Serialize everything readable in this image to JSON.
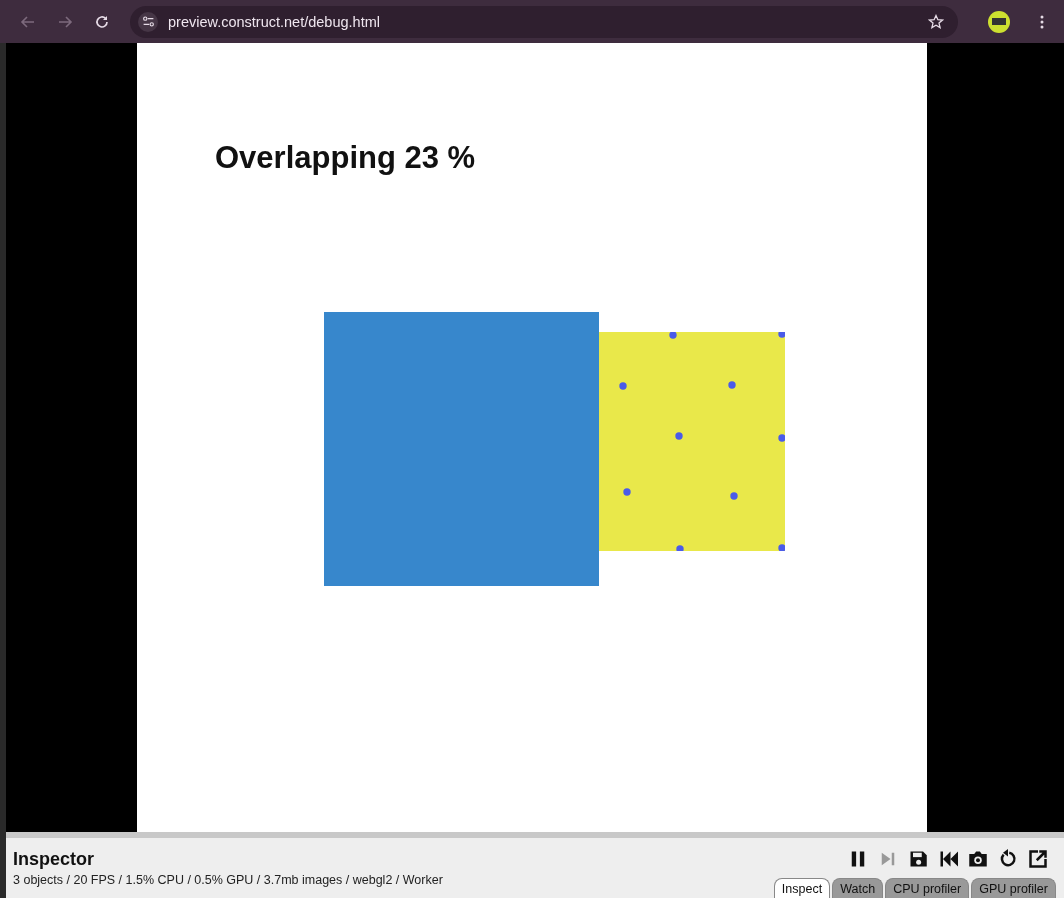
{
  "browser": {
    "url": "preview.construct.net/debug.html",
    "back_disabled": true,
    "forward_disabled": true
  },
  "game": {
    "title": "Overlapping 23 %"
  },
  "inspector": {
    "title": "Inspector",
    "stats": "3 objects / 20 FPS / 1.5% CPU / 0.5% GPU / 3.7mb images / webgl2 / Worker",
    "tools": [
      {
        "kind": "pause",
        "disabled": false
      },
      {
        "kind": "step",
        "disabled": true
      },
      {
        "kind": "save",
        "disabled": false
      },
      {
        "kind": "rewind",
        "disabled": false
      },
      {
        "kind": "camera",
        "disabled": false
      },
      {
        "kind": "restart",
        "disabled": false
      },
      {
        "kind": "popout",
        "disabled": false
      }
    ],
    "tabs": [
      {
        "label": "Inspect",
        "selected": true
      },
      {
        "label": "Watch",
        "selected": false
      },
      {
        "label": "CPU profiler",
        "selected": false
      },
      {
        "label": "GPU profiler",
        "selected": false
      }
    ]
  }
}
